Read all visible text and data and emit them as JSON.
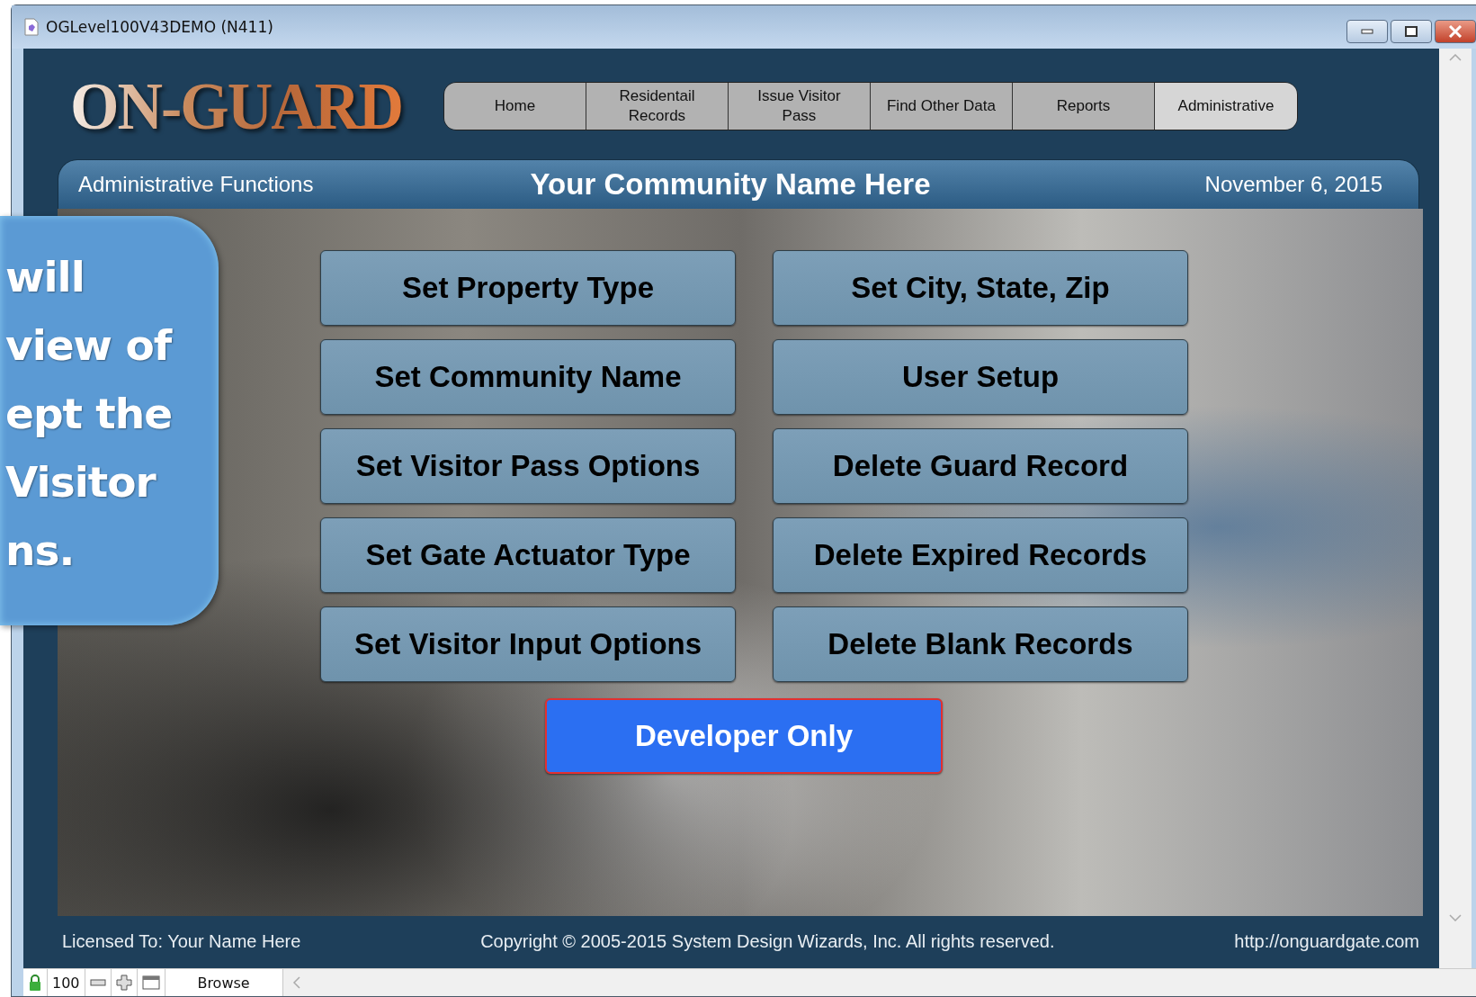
{
  "window": {
    "title": "OGLevel100V43DEMO (N411)"
  },
  "logo": "ON-GUARD",
  "tabs": [
    {
      "label": "Home",
      "selected": false
    },
    {
      "label": "Residentail Records",
      "selected": false
    },
    {
      "label": "Issue Visitor Pass",
      "selected": false
    },
    {
      "label": "Find Other Data",
      "selected": false
    },
    {
      "label": "Reports",
      "selected": false
    },
    {
      "label": "Administrative",
      "selected": true
    }
  ],
  "header": {
    "section": "Administrative Functions",
    "community": "Your Community Name Here",
    "date": "November 6, 2015"
  },
  "buttons": [
    {
      "label": "Set Property Type",
      "kind": "standard"
    },
    {
      "label": "Set City, State, Zip",
      "kind": "standard"
    },
    {
      "label": "Set Community Name",
      "kind": "standard"
    },
    {
      "label": "User Setup",
      "kind": "standard"
    },
    {
      "label": "Set Visitor Pass Options",
      "kind": "standard"
    },
    {
      "label": "Delete Guard Record",
      "kind": "standard"
    },
    {
      "label": "Set Gate Actuator Type",
      "kind": "standard"
    },
    {
      "label": "Delete Expired Records",
      "kind": "standard"
    },
    {
      "label": "Set Visitor Input Options",
      "kind": "standard"
    },
    {
      "label": "Delete Blank Records",
      "kind": "standard"
    },
    {
      "label": "Developer Only",
      "kind": "developer"
    }
  ],
  "callout": {
    "lines": [
      "will",
      "view of",
      "ept the",
      "Visitor",
      "ns."
    ]
  },
  "footer": {
    "license": "Licensed To: Your Name Here",
    "copyright": "Copyright © 2005-2015 System Design Wizards, Inc. All rights reserved.",
    "url": "http://onguardgate.com"
  },
  "status_bar": {
    "zoom": "100",
    "mode": "Browse"
  }
}
